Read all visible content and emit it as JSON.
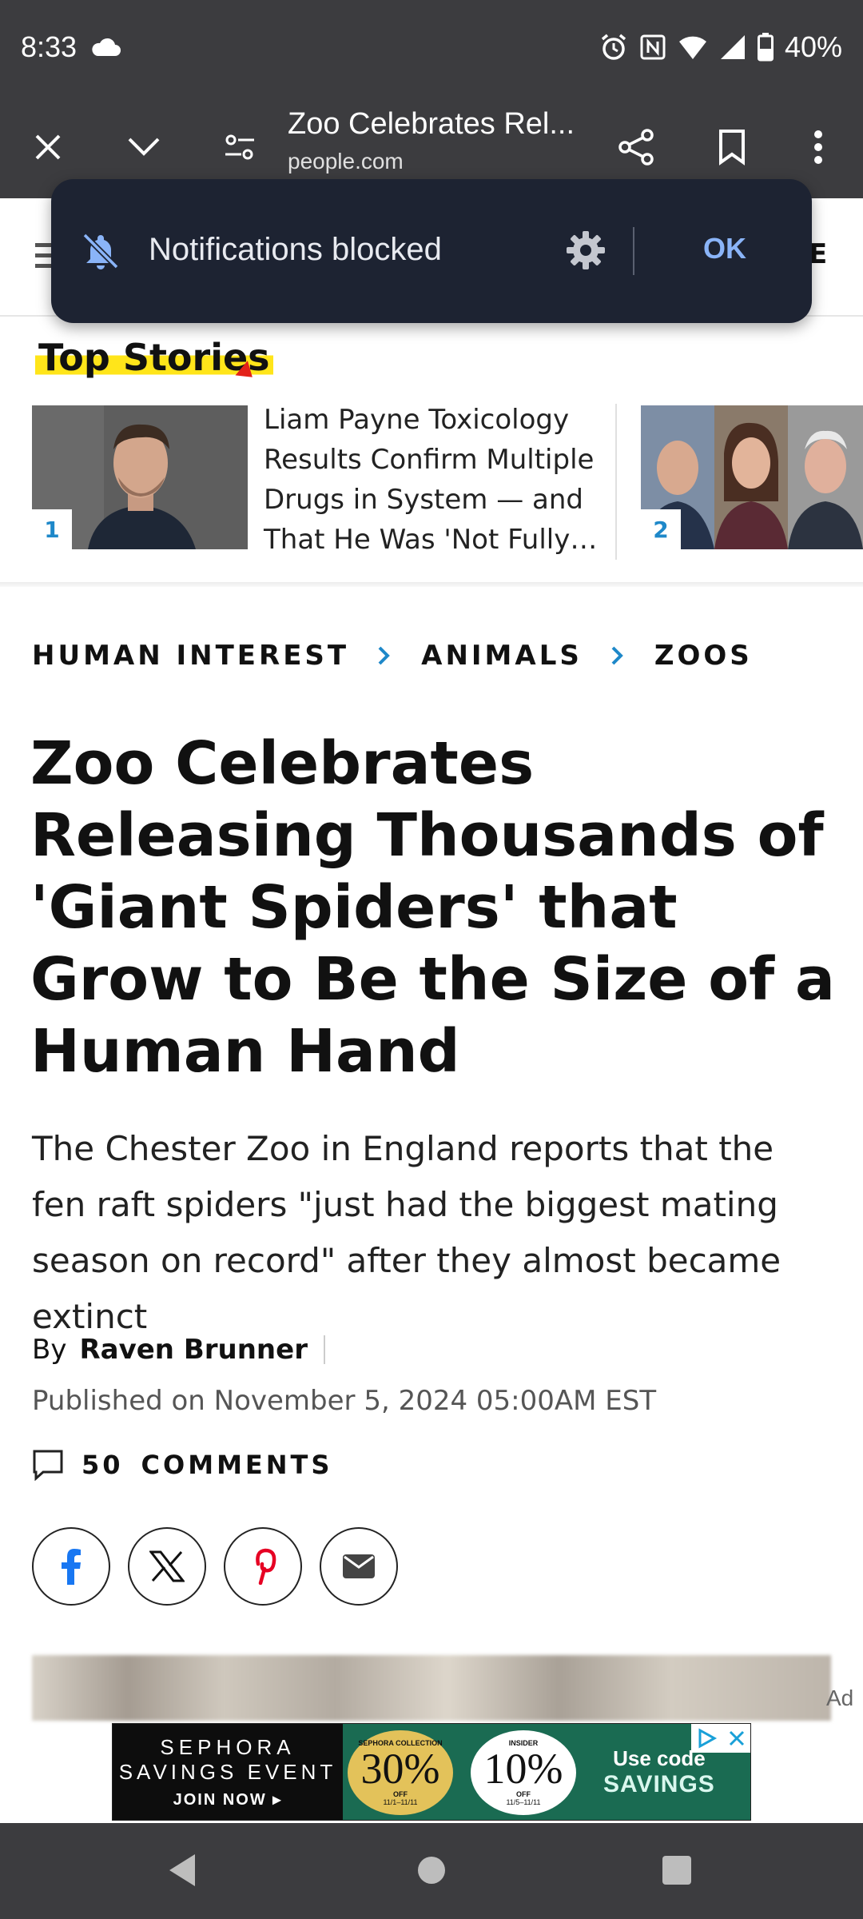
{
  "status": {
    "time": "8:33",
    "battery": "40%"
  },
  "browser": {
    "tab_title": "Zoo Celebrates Rel...",
    "url": "people.com"
  },
  "toast": {
    "text": "Notifications blocked",
    "ok": "OK"
  },
  "header": {
    "edge_letter": "E"
  },
  "top_stories": {
    "label": "Top Stories",
    "items": [
      {
        "num": "1",
        "headline": "Liam Payne Toxicology Results Confirm Multiple Drugs in System — and That He Was 'Not Fully…"
      },
      {
        "num": "2"
      }
    ]
  },
  "breadcrumb": [
    "HUMAN INTEREST",
    "ANIMALS",
    "ZOOS"
  ],
  "article": {
    "headline": "Zoo Celebrates Releasing Thousands of 'Giant Spiders' that Grow to Be the Size of a Human Hand",
    "dek": "The Chester Zoo in England reports that the fen raft spiders \"just had the biggest mating season on record\" after they almost became extinct",
    "by": "By",
    "author": "Raven Brunner",
    "published": "Published on November 5, 2024 05:00AM EST",
    "comments_count": "50",
    "comments_label": "COMMENTS"
  },
  "ad": {
    "label": "Ad",
    "line1": "SEPHORA",
    "line2": "SAVINGS EVENT",
    "line3": "JOIN NOW",
    "coin1_top": "SEPHORA COLLECTION",
    "coin1_value": "30%",
    "coin1_off": "OFF",
    "coin1_date": "11/1–11/11",
    "coin2_top": "INSIDER",
    "coin2_value": "10%",
    "coin2_off": "OFF",
    "coin2_date": "11/5–11/11",
    "code_line1": "Use code",
    "code_line2": "SAVINGS"
  },
  "colors": {
    "accent": "#1e88c9",
    "highlight": "#ffe51a",
    "toolbar": "#3c3c3f",
    "toast": "#1d2332",
    "ad_green": "#1a6b52"
  }
}
